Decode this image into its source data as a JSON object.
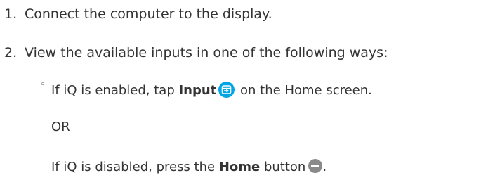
{
  "steps": [
    {
      "number": "1.",
      "text": "Connect the computer to the display."
    },
    {
      "number": "2.",
      "text": "View the available inputs in one of the following ways:"
    }
  ],
  "sub_steps": {
    "bullet": "◦",
    "option1": {
      "prefix": "If iQ is enabled, tap ",
      "bold": "Input",
      "icon": "input-icon",
      "suffix": " on the Home screen."
    },
    "separator": "OR",
    "option2": {
      "prefix": "If iQ is disabled, press the ",
      "bold": "Home",
      "middle": " button",
      "icon": "home-button-icon",
      "suffix": "."
    }
  },
  "colors": {
    "text": "#333333",
    "input_icon": "#00a5e3",
    "home_icon": "#8a8a8a"
  }
}
